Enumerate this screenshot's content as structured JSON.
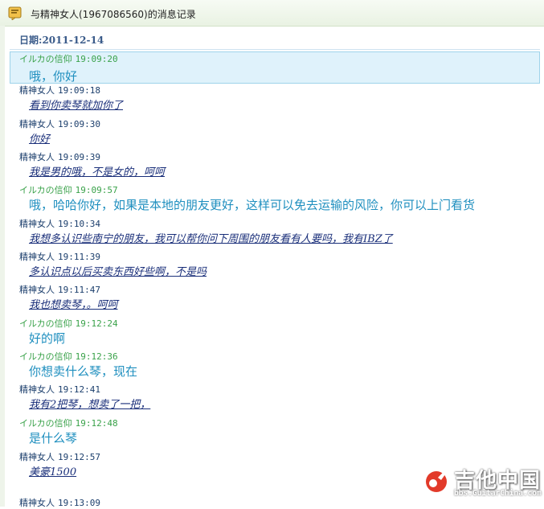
{
  "window": {
    "title": "与精神女人(1967086560)的消息记录"
  },
  "date": {
    "label": "日期:",
    "value": "2011-12-14"
  },
  "messages": [
    {
      "sender": "イルカの信仰",
      "time": "19:09:20",
      "text": "哦，你好",
      "role": "self",
      "selected": true
    },
    {
      "sender": "精神女人",
      "time": "19:09:18",
      "text": "看到你卖琴就加你了",
      "role": "other"
    },
    {
      "sender": "精神女人",
      "time": "19:09:30",
      "text": "你好",
      "role": "other"
    },
    {
      "sender": "精神女人",
      "time": "19:09:39",
      "text": "我是男的哦，不是女的，呵呵",
      "role": "other"
    },
    {
      "sender": "イルカの信仰",
      "time": "19:09:57",
      "text": "哦，哈哈你好，如果是本地的朋友更好，这样可以免去运输的风险，你可以上门看货",
      "role": "self"
    },
    {
      "sender": "精神女人",
      "time": "19:10:34",
      "text": "我想多认识些南宁的朋友，我可以帮你问下周围的朋友看有人要吗，我有IBZ了",
      "role": "other"
    },
    {
      "sender": "精神女人",
      "time": "19:11:39",
      "text": "多认识点以后买卖东西好些啊，不是吗",
      "role": "other"
    },
    {
      "sender": "精神女人",
      "time": "19:11:47",
      "text": "我也想卖琴，。呵呵",
      "role": "other"
    },
    {
      "sender": "イルカの信仰",
      "time": "19:12:24",
      "text": "好的啊",
      "role": "self"
    },
    {
      "sender": "イルカの信仰",
      "time": "19:12:36",
      "text": "你想卖什么琴，现在",
      "role": "self"
    },
    {
      "sender": "精神女人",
      "time": "19:12:41",
      "text": "我有2把琴，想卖了一把，",
      "role": "other"
    },
    {
      "sender": "イルカの信仰",
      "time": "19:12:48",
      "text": "是什么琴",
      "role": "self"
    },
    {
      "sender": "精神女人",
      "time": "19:12:57",
      "text": "美豪1500",
      "role": "other"
    },
    {
      "sender": "精神女人",
      "time": "19:13:09",
      "text": "",
      "role": "other"
    }
  ],
  "watermark": {
    "name": "吉他中国",
    "url": "bbs.GuitarChina.com"
  },
  "colors": {
    "self_header": "#3aa24a",
    "self_body": "#1f8fbf",
    "other_header": "#1b3e6c",
    "other_body": "#1a2f7a",
    "selected_bg": "#dff2fb"
  },
  "icons": {
    "title": "chat-history-icon",
    "watermark": "guitar-logo-icon"
  }
}
